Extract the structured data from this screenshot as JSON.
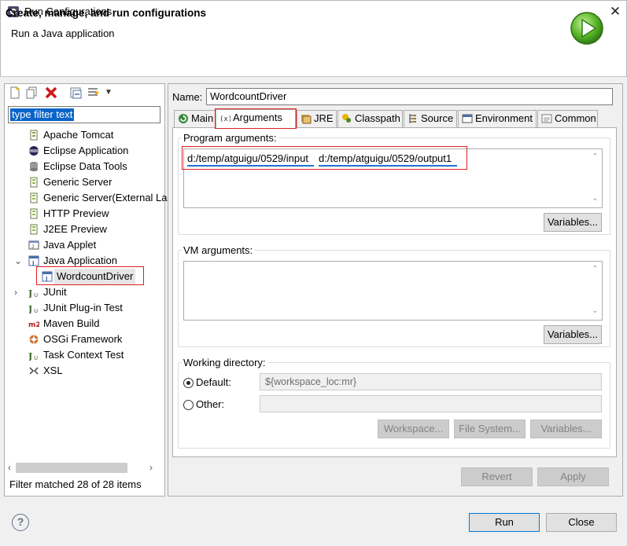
{
  "window": {
    "title": "Run Configurations",
    "close_glyph": "✕"
  },
  "header": {
    "title": "Create, manage, and run configurations",
    "subtitle": "Run a Java application"
  },
  "left": {
    "filter_placeholder": "type filter text",
    "tree": [
      {
        "label": "Apache Tomcat",
        "icon": "tomcat-icon"
      },
      {
        "label": "Eclipse Application",
        "icon": "eclipse-icon"
      },
      {
        "label": "Eclipse Data Tools",
        "icon": "database-icon"
      },
      {
        "label": "Generic Server",
        "icon": "server-icon"
      },
      {
        "label": "Generic Server(External La",
        "icon": "server-icon"
      },
      {
        "label": "HTTP Preview",
        "icon": "server-icon"
      },
      {
        "label": "J2EE Preview",
        "icon": "server-icon"
      },
      {
        "label": "Java Applet",
        "icon": "applet-icon"
      },
      {
        "label": "Java Application",
        "icon": "java-app-icon",
        "expanded": true
      },
      {
        "label": "WordcountDriver",
        "icon": "java-app-icon",
        "child": true,
        "selected": true
      },
      {
        "label": "JUnit",
        "icon": "junit-icon",
        "collapsed": true
      },
      {
        "label": "JUnit Plug-in Test",
        "icon": "junit-icon"
      },
      {
        "label": "Maven Build",
        "icon": "maven-icon"
      },
      {
        "label": "OSGi Framework",
        "icon": "osgi-icon"
      },
      {
        "label": "Task Context Test",
        "icon": "junit-icon"
      },
      {
        "label": "XSL",
        "icon": "xsl-icon"
      }
    ],
    "status": "Filter matched 28 of 28 items"
  },
  "right": {
    "name_label": "Name:",
    "name_value": "WordcountDriver",
    "tabs": [
      {
        "label": "Main",
        "icon": "main-tab-icon"
      },
      {
        "label": "Arguments",
        "icon": "arguments-tab-icon",
        "active": true
      },
      {
        "label": "JRE",
        "icon": "jre-tab-icon"
      },
      {
        "label": "Classpath",
        "icon": "classpath-tab-icon"
      },
      {
        "label": "Source",
        "icon": "source-tab-icon"
      },
      {
        "label": "Environment",
        "icon": "environment-tab-icon"
      },
      {
        "label": "Common",
        "icon": "common-tab-icon"
      }
    ],
    "program_args": {
      "title": "Program arguments:",
      "arg1": "d:/temp/atguigu/0529/input",
      "arg2": "d:/temp/atguigu/0529/output1",
      "variables": "Variables..."
    },
    "vm_args": {
      "title": "VM arguments:",
      "variables": "Variables..."
    },
    "working_dir": {
      "title": "Working directory:",
      "default_label": "Default:",
      "default_value": "${workspace_loc:mr}",
      "other_label": "Other:",
      "other_value": "",
      "workspace_btn": "Workspace...",
      "filesystem_btn": "File System...",
      "variables_btn": "Variables..."
    },
    "revert": "Revert",
    "apply": "Apply"
  },
  "footer": {
    "help": "?",
    "run": "Run",
    "close": "Close"
  },
  "colors": {
    "accent": "#0078d7",
    "highlight": "#e02020",
    "selection": "#0a64c8"
  }
}
